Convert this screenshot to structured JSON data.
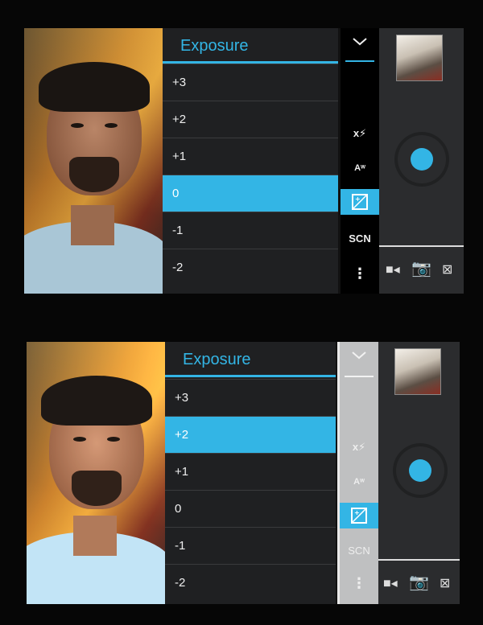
{
  "panels": [
    {
      "menu_title": "Exposure",
      "options": [
        "+3",
        "+2",
        "+1",
        "0",
        "-1",
        "-2"
      ],
      "selected": "0",
      "sidebar": {
        "top_icon": "chevron-down-icon",
        "flash_icon": "flash-auto-icon",
        "wb_icon": "white-balance-auto-icon",
        "exposure_icon": "exposure-icon",
        "scene_label": "SCN",
        "more_icon": "overflow-dots-icon"
      },
      "modes": [
        "video-icon",
        "camera-icon",
        "panorama-icon"
      ]
    },
    {
      "menu_title": "Exposure",
      "options": [
        "+3",
        "+2",
        "+1",
        "0",
        "-1",
        "-2"
      ],
      "selected": "+2",
      "sidebar": {
        "top_icon": "chevron-down-icon",
        "flash_icon": "flash-auto-icon",
        "wb_icon": "white-balance-auto-icon",
        "exposure_icon": "exposure-icon",
        "scene_label": "SCN",
        "more_icon": "overflow-dots-icon"
      },
      "modes": [
        "video-icon",
        "camera-icon",
        "panorama-icon"
      ]
    }
  ],
  "colors": {
    "accent": "#33b5e5",
    "menu_bg": "#1f2022",
    "panel_bg": "#2b2c2e"
  }
}
